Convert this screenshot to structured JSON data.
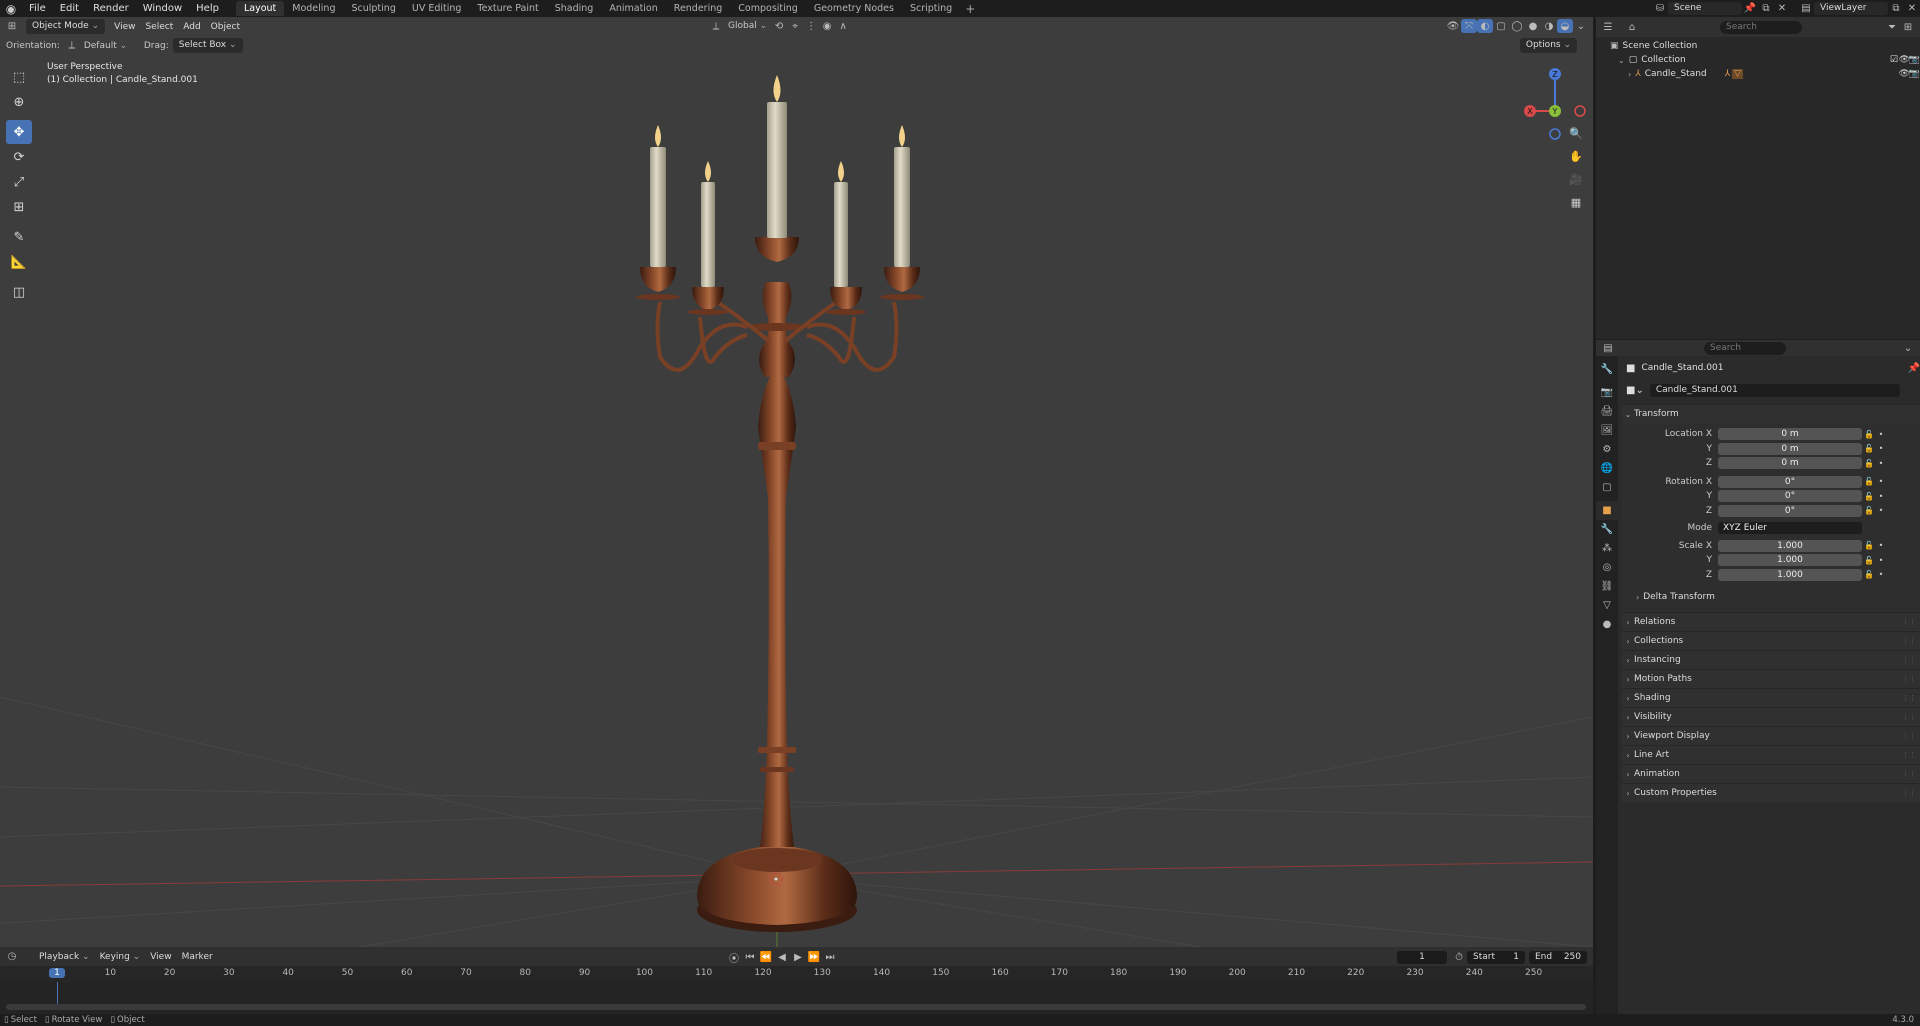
{
  "topbar": {
    "menus": [
      "File",
      "Edit",
      "Render",
      "Window",
      "Help"
    ],
    "tabs": [
      "Layout",
      "Modeling",
      "Sculpting",
      "UV Editing",
      "Texture Paint",
      "Shading",
      "Animation",
      "Rendering",
      "Compositing",
      "Geometry Nodes",
      "Scripting"
    ],
    "active_tab": "Layout",
    "scene": "Scene",
    "view_layer": "ViewLayer"
  },
  "viewport": {
    "mode": "Object Mode",
    "menus": [
      "View",
      "Select",
      "Add",
      "Object"
    ],
    "transform_orientation": "Global",
    "orientation_label": "Orientation:",
    "orientation_value": "Default",
    "drag_label": "Drag:",
    "drag_value": "Select Box",
    "options": "Options",
    "info_line1": "User Perspective",
    "info_line2": "(1) Collection | Candle_Stand.001",
    "axis_labels": {
      "x": "X",
      "y": "Y",
      "z": "Z"
    }
  },
  "timeline": {
    "menus": [
      "Playback",
      "Keying",
      "View",
      "Marker"
    ],
    "current_frame": "1",
    "start_label": "Start",
    "start": "1",
    "end_label": "End",
    "end": "250",
    "ruler": [
      "1",
      "10",
      "20",
      "30",
      "40",
      "50",
      "60",
      "70",
      "80",
      "90",
      "100",
      "110",
      "120",
      "130",
      "140",
      "150",
      "160",
      "170",
      "180",
      "190",
      "200",
      "210",
      "220",
      "230",
      "240",
      "250"
    ]
  },
  "statusbar": {
    "select": "Select",
    "rotate": "Rotate View",
    "object": "Object",
    "version": "4.3.0"
  },
  "outliner": {
    "search_placeholder": "Search",
    "scene_collection": "Scene Collection",
    "collection": "Collection",
    "object": "Candle_Stand"
  },
  "properties": {
    "search_placeholder": "Search",
    "object_name": "Candle_Stand.001",
    "data_name": "Candle_Stand.001",
    "transform": {
      "title": "Transform",
      "location_label": "Location X",
      "location": [
        "0 m",
        "0 m",
        "0 m"
      ],
      "rotation_label": "Rotation X",
      "rotation": [
        "0°",
        "0°",
        "0°"
      ],
      "mode_label": "Mode",
      "mode": "XYZ Euler",
      "scale_label": "Scale X",
      "scale": [
        "1.000",
        "1.000",
        "1.000"
      ],
      "y": "Y",
      "z": "Z",
      "delta": "Delta Transform"
    },
    "panels": [
      "Relations",
      "Collections",
      "Instancing",
      "Motion Paths",
      "Shading",
      "Visibility",
      "Viewport Display",
      "Line Art",
      "Animation",
      "Custom Properties"
    ]
  },
  "colors": {
    "accent": "#4772b3",
    "viewport_bg": "#3d3d3d",
    "bronze": "#6b3a22"
  }
}
